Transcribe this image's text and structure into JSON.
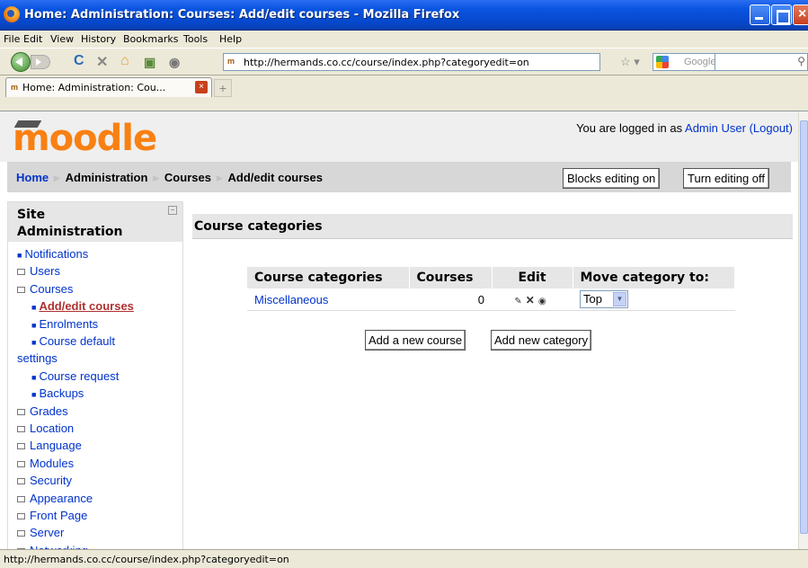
{
  "window": {
    "title": "Home: Administration: Courses: Add/edit courses - Mozilla Firefox"
  },
  "menu": [
    "File",
    "Edit",
    "View",
    "History",
    "Bookmarks",
    "Tools",
    "Help"
  ],
  "navbar": {
    "url": "http://hermands.co.cc/course/index.php?categoryedit=on",
    "search_placeholder": "Google"
  },
  "tab": {
    "label": "Home: Administration: Cou...",
    "new_tab": "+"
  },
  "header": {
    "logo": "moodle",
    "logged_in_prefix": "You are logged in as ",
    "user": "Admin User",
    "logout": "(Logout)"
  },
  "breadcrumb": [
    "Home",
    "Administration",
    "Courses",
    "Add/edit courses"
  ],
  "buttons": {
    "blocks_editing": "Blocks editing on",
    "turn_editing": "Turn editing off",
    "add_course": "Add a new course",
    "add_category": "Add new category"
  },
  "sidebar": {
    "title_line1": "Site",
    "title_line2": "Administration",
    "items": [
      {
        "label": "Notifications",
        "type": "bullet"
      },
      {
        "label": "Users",
        "type": "folder"
      },
      {
        "label": "Courses",
        "type": "folder-open"
      },
      {
        "label": "Add/edit courses",
        "type": "sub-active"
      },
      {
        "label": "Enrolments",
        "type": "sub"
      },
      {
        "label": "Course default",
        "type": "sub"
      },
      {
        "label": "settings",
        "type": "wrap"
      },
      {
        "label": "Course request",
        "type": "sub"
      },
      {
        "label": "Backups",
        "type": "sub"
      },
      {
        "label": "Grades",
        "type": "folder"
      },
      {
        "label": "Location",
        "type": "folder"
      },
      {
        "label": "Language",
        "type": "folder"
      },
      {
        "label": "Modules",
        "type": "folder"
      },
      {
        "label": "Security",
        "type": "folder"
      },
      {
        "label": "Appearance",
        "type": "folder"
      },
      {
        "label": "Front Page",
        "type": "folder"
      },
      {
        "label": "Server",
        "type": "folder"
      },
      {
        "label": "Networking",
        "type": "folder"
      }
    ]
  },
  "main": {
    "heading": "Course categories",
    "table": {
      "headers": [
        "Course categories",
        "Courses",
        "Edit",
        "Move category to:"
      ],
      "rows": [
        {
          "name": "Miscellaneous",
          "courses": "0",
          "move_to": "Top"
        }
      ]
    }
  },
  "status": "http://hermands.co.cc/course/index.php?categoryedit=on",
  "colors": {
    "link": "#0033cc",
    "logo": "#f98012",
    "active": "#b03030"
  }
}
